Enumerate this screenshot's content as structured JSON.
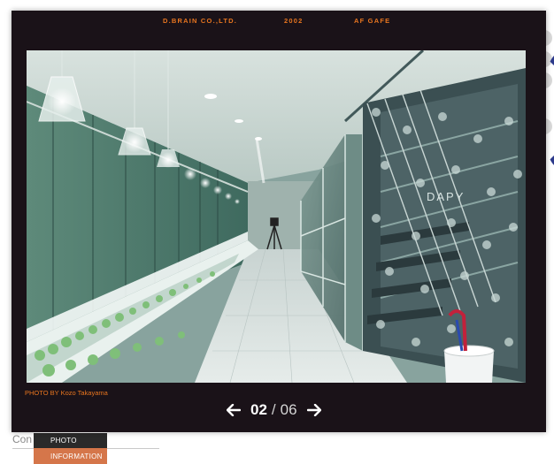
{
  "background_page": {
    "content_label": "Con",
    "tabs": [
      {
        "label": "PHOTO",
        "color": "#2a2a2a"
      },
      {
        "label": "INFORMATION",
        "color": "#d5764a"
      }
    ]
  },
  "lightbox": {
    "header": {
      "company": "D.BRAIN CO.,LTD.",
      "year": "2002",
      "project": "AF GAFE"
    },
    "photo": {
      "credit": "PHOTO BY Kozo Takayama",
      "sign_text": "DAPY"
    },
    "pager": {
      "current": "02",
      "separator": "/",
      "total": "06",
      "prev_icon": "arrow-left-icon",
      "next_icon": "arrow-right-icon"
    },
    "colors": {
      "accent": "#e8751f",
      "frame": "#1a1218"
    }
  }
}
